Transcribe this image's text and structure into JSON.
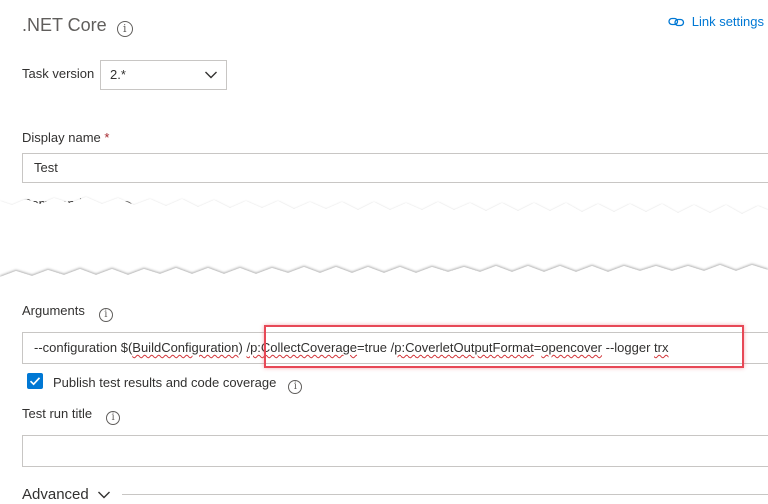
{
  "header": {
    "title": ".NET Core",
    "link_settings": "Link settings"
  },
  "task_version": {
    "label": "Task version",
    "value": "2.*"
  },
  "display_name": {
    "label": "Display name",
    "required_mark": "*",
    "value": "Test"
  },
  "command": {
    "label": "Command",
    "required_mark": "*"
  },
  "arguments": {
    "label": "Arguments",
    "value_parts": [
      "--configuration $(",
      "BuildConfiguration",
      ") ",
      "/p:CollectCoverage",
      "=true /",
      "p:CoverletOutputFormat",
      "=",
      "opencover",
      " --logger ",
      "trx"
    ]
  },
  "publish": {
    "label": "Publish test results and code coverage",
    "checked": true
  },
  "test_run_title": {
    "label": "Test run title",
    "value": ""
  },
  "advanced": {
    "label": "Advanced"
  },
  "colors": {
    "accent": "#0078d4",
    "highlight_border": "#e74856",
    "required": "#a4262c"
  }
}
